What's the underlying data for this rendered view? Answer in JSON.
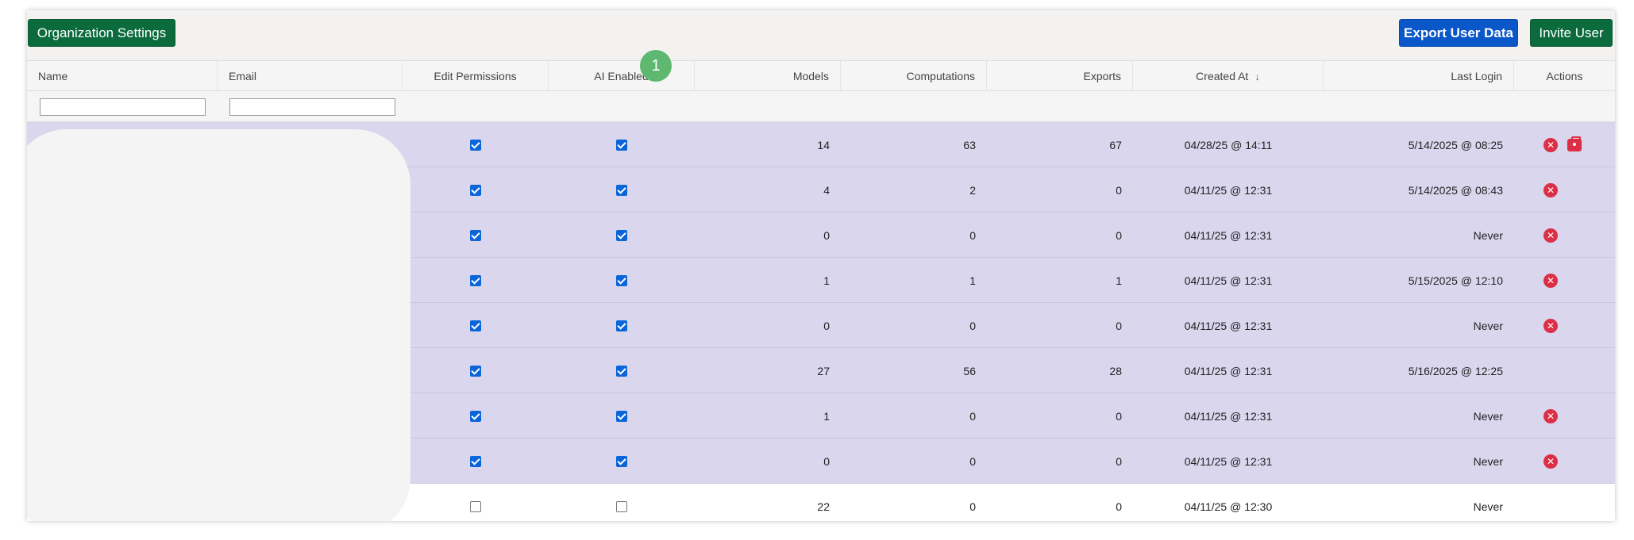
{
  "toolbar": {
    "org_settings_label": "Organization Settings",
    "export_label": "Export User Data",
    "invite_label": "Invite User",
    "colors": {
      "green": "#0b6b3d",
      "blue": "#0a57c9"
    }
  },
  "step_marker": "1",
  "table": {
    "columns": {
      "name": "Name",
      "email": "Email",
      "edit_permissions": "Edit Permissions",
      "ai_enabled": "AI Enabled",
      "models": "Models",
      "computations": "Computations",
      "exports": "Exports",
      "created_at": "Created At",
      "last_login": "Last Login",
      "actions": "Actions"
    },
    "sort_indicator": "↓",
    "rows": [
      {
        "edit": true,
        "ai": true,
        "models": "14",
        "computations": "63",
        "exports": "67",
        "created": "04/28/25 @ 14:11",
        "last_login": "5/14/2025 @ 08:25",
        "remove": "✕",
        "badge": true,
        "selected": true
      },
      {
        "edit": true,
        "ai": true,
        "models": "4",
        "computations": "2",
        "exports": "0",
        "created": "04/11/25 @ 12:31",
        "last_login": "5/14/2025 @ 08:43",
        "remove": "✕",
        "badge": false,
        "selected": true
      },
      {
        "edit": true,
        "ai": true,
        "models": "0",
        "computations": "0",
        "exports": "0",
        "created": "04/11/25 @ 12:31",
        "last_login": "Never",
        "remove": "✕",
        "badge": false,
        "selected": true
      },
      {
        "edit": true,
        "ai": true,
        "models": "1",
        "computations": "1",
        "exports": "1",
        "created": "04/11/25 @ 12:31",
        "last_login": "5/15/2025 @ 12:10",
        "remove": "✕",
        "badge": false,
        "selected": true
      },
      {
        "edit": true,
        "ai": true,
        "models": "0",
        "computations": "0",
        "exports": "0",
        "created": "04/11/25 @ 12:31",
        "last_login": "Never",
        "remove": "✕",
        "badge": false,
        "selected": true
      },
      {
        "edit": true,
        "ai": true,
        "models": "27",
        "computations": "56",
        "exports": "28",
        "created": "04/11/25 @ 12:31",
        "last_login": "5/16/2025 @ 12:25",
        "remove": "",
        "badge": false,
        "selected": true
      },
      {
        "edit": true,
        "ai": true,
        "models": "1",
        "computations": "0",
        "exports": "0",
        "created": "04/11/25 @ 12:31",
        "last_login": "Never",
        "remove": "✕",
        "badge": false,
        "selected": true
      },
      {
        "edit": true,
        "ai": true,
        "models": "0",
        "computations": "0",
        "exports": "0",
        "created": "04/11/25 @ 12:31",
        "last_login": "Never",
        "remove": "✕",
        "badge": false,
        "selected": true
      },
      {
        "edit": false,
        "ai": false,
        "models": "22",
        "computations": "0",
        "exports": "0",
        "created": "04/11/25 @ 12:30",
        "last_login": "Never",
        "remove": "",
        "badge": false,
        "selected": false
      }
    ]
  }
}
